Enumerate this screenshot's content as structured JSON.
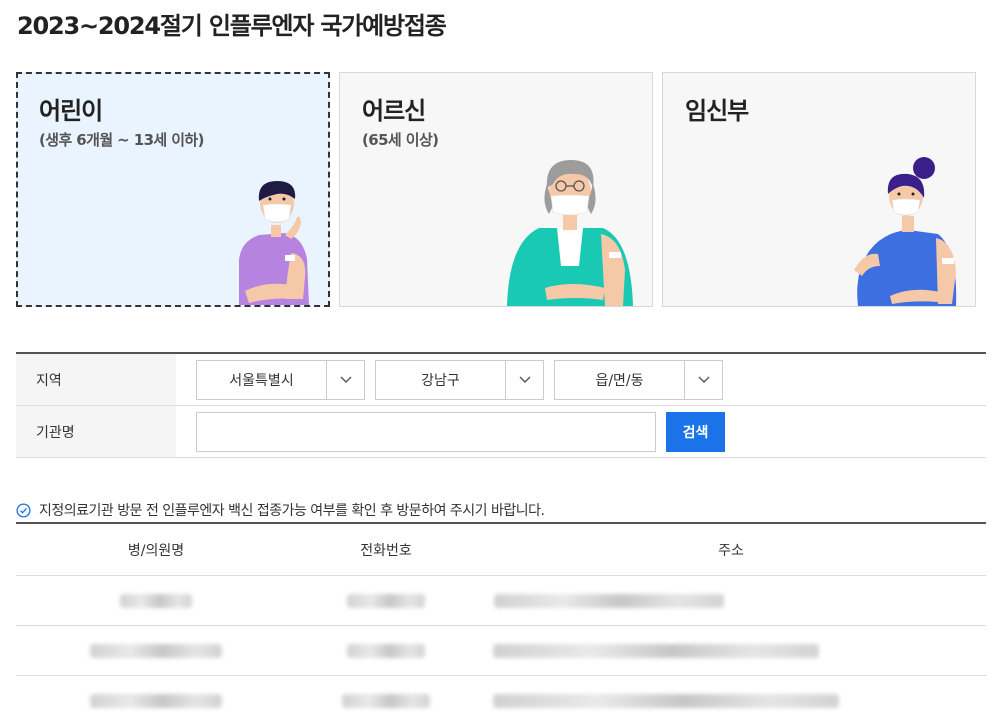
{
  "page": {
    "title": "2023~2024절기 인플루엔자 국가예방접종"
  },
  "cards": [
    {
      "title": "어린이",
      "subtitle": "(생후 6개월 ~ 13세 이하)",
      "illustration": "child-illustration"
    },
    {
      "title": "어르신",
      "subtitle": "(65세 이상)",
      "illustration": "elder-illustration"
    },
    {
      "title": "임신부",
      "subtitle": "",
      "illustration": "pregnant-illustration"
    }
  ],
  "search": {
    "region_label": "지역",
    "sido": "서울특별시",
    "sigungu": "강남구",
    "dong": "읍/면/동",
    "name_label": "기관명",
    "name_value": "",
    "search_button": "검색"
  },
  "notice": {
    "text": "지정의료기관 방문 전 인플루엔자 백신 접종가능 여부를 확인 후 방문하여 주시기 바랍니다.",
    "icon": "check-circle-icon"
  },
  "results": {
    "headers": [
      "병/의원명",
      "전화번호",
      "주소"
    ],
    "rows_blurred": 3
  },
  "colors": {
    "accent": "#1a73e8",
    "active_card_bg": "#eaf4ff",
    "card_bg": "#f7f7f7"
  }
}
